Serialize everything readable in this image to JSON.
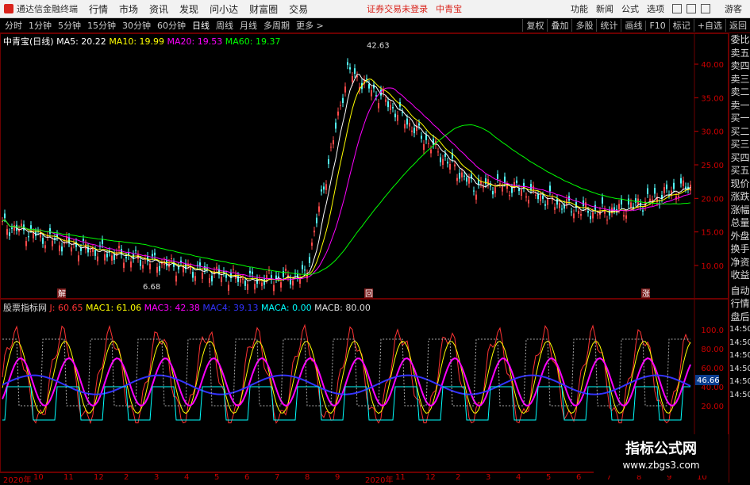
{
  "app": {
    "title": "通达信金融终端",
    "login_notice": "证券交易未登录",
    "stock": "中青宝",
    "guest": "游客"
  },
  "top_menu": [
    "行情",
    "市场",
    "资讯",
    "发现",
    "问小达",
    "财富圈",
    "交易"
  ],
  "top_right": [
    "功能",
    "新闻",
    "公式",
    "选项"
  ],
  "periods": [
    {
      "label": "分时",
      "active": false
    },
    {
      "label": "1分钟",
      "active": false
    },
    {
      "label": "5分钟",
      "active": false
    },
    {
      "label": "15分钟",
      "active": false
    },
    {
      "label": "30分钟",
      "active": false
    },
    {
      "label": "60分钟",
      "active": false
    },
    {
      "label": "日线",
      "active": true
    },
    {
      "label": "周线",
      "active": false
    },
    {
      "label": "月线",
      "active": false
    },
    {
      "label": "多周期",
      "active": false
    },
    {
      "label": "更多 >",
      "active": false
    }
  ],
  "tools_right": [
    "复权",
    "叠加",
    "多股",
    "统计",
    "画线",
    "F10",
    "标记",
    "+自选",
    "返回"
  ],
  "main_legend": {
    "name": "中青宝(日线)",
    "ma5": "MA5: 20.22",
    "ma10": "MA10: 19.99",
    "ma20": "MA20: 19.53",
    "ma60": "MA60: 19.37"
  },
  "price_axis": [
    "40.00",
    "35.00",
    "30.00",
    "25.00",
    "20.00",
    "15.00",
    "10.00"
  ],
  "price_annotations": {
    "high": "42.63",
    "low": "6.68"
  },
  "event_markers": [
    "解",
    "回",
    "涨"
  ],
  "sub_legend": {
    "name": "股票指标网",
    "j": "J: 60.65",
    "mac1": "MAC1: 61.06",
    "mac3": "MAC3: 42.38",
    "mac4": "MAC4: 39.13",
    "maca": "MACA: 0.00",
    "macb": "MACB: 80.00"
  },
  "sub_axis": [
    "100.0",
    "80.00",
    "60.00",
    "40.00",
    "20.00"
  ],
  "sub_current": "46.66",
  "sidebar": [
    "委比",
    "卖五",
    "卖四",
    "卖三",
    "卖二",
    "卖一",
    "买一",
    "买二",
    "买三",
    "买四",
    "买五",
    "现价",
    "涨跌",
    "涨幅",
    "总量",
    "外盘",
    "换手",
    "净资",
    "收益"
  ],
  "sidebar2": [
    "自动",
    "行情",
    "盘后",
    "14:50",
    "14:50",
    "14:50",
    "14:50",
    "14:50",
    "14:50"
  ],
  "time_axis": [
    "2020年",
    "10",
    "11",
    "12",
    "2",
    "3",
    "4",
    "5",
    "6",
    "7",
    "8",
    "9",
    "2020年",
    "11",
    "12",
    "2",
    "3",
    "4",
    "5",
    "6",
    "7",
    "8",
    "9",
    "10"
  ],
  "watermark": {
    "line1": "指标公式网",
    "line2": "www.zbgs3.com"
  },
  "colors": {
    "ma5": "#ffffff",
    "ma10": "#ffff00",
    "ma20": "#ff00ff",
    "ma60": "#00ff00",
    "axis": "#cc0000",
    "j": "#ff3333",
    "mac1": "#ffff00",
    "mac3": "#ff00ff",
    "mac4": "#3333ff",
    "maca": "#00ffff"
  }
}
